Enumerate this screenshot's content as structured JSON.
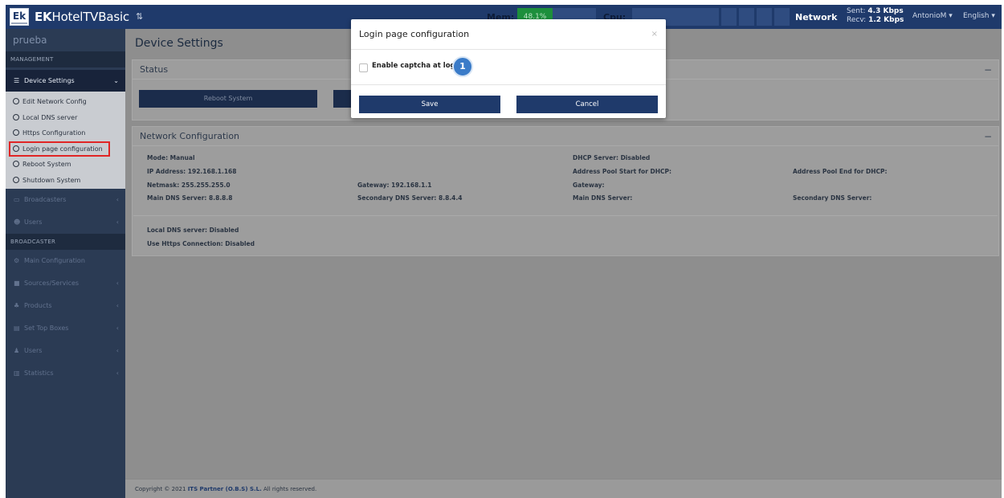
{
  "topbar": {
    "logo_text": "Ek",
    "brand_bold": "EK",
    "brand_rest": "HotelTVBasic",
    "toggle_glyph": "⇅",
    "mem_label": "Mem:",
    "mem_value": "48.1%",
    "mem_fraction": 0.45,
    "cpu_label": "Cpu:",
    "network_label": "Network",
    "sent_label": "Sent:",
    "sent_value": "4.3 Kbps",
    "recv_label": "Recv:",
    "recv_value": "1.2 Kbps",
    "user": "AntonioM ▾",
    "language": "English ▾"
  },
  "sidebar": {
    "site_name": "prueba",
    "management_header": "MANAGEMENT",
    "device_settings": "Device Settings",
    "sub_items": [
      "Edit Network Config",
      "Local DNS server",
      "Https Configuration",
      "Login page configuration",
      "Reboot System",
      "Shutdown System"
    ],
    "broadcasters": "Broadcasters",
    "users_mgmt": "Users",
    "broadcaster_header": "BROADCASTER",
    "bc_items": [
      "Main Configuration",
      "Sources/Services",
      "Products",
      "Set Top Boxes",
      "Users",
      "Statistics"
    ]
  },
  "main": {
    "page_title": "Device Settings",
    "status_panel_title": "Status",
    "reboot_button": "Reboot System",
    "network_panel_title": "Network Configuration",
    "mode": "Mode: Manual",
    "ip": "IP Address: 192.168.1.168",
    "netmask": "Netmask: 255.255.255.0",
    "gateway": "Gateway: 192.168.1.1",
    "main_dns": "Main DNS Server: 8.8.8.8",
    "secondary_dns": "Secondary DNS Server: 8.8.4.4",
    "dhcp_server": "DHCP Server: Disabled",
    "pool_start": "Address Pool Start for DHCP:",
    "pool_end": "Address Pool End for DHCP:",
    "dhcp_gateway": "Gateway:",
    "dhcp_main_dns": "Main DNS Server:",
    "dhcp_secondary_dns": "Secondary DNS Server:",
    "local_dns": "Local DNS server: Disabled",
    "https": "Use Https Connection: Disabled",
    "collapse_glyph": "−"
  },
  "footer": {
    "prefix": "Copyright © 2021 ",
    "company": "ITS Partner (O.B.S) S.L.",
    "suffix": " All rights reserved."
  },
  "modal": {
    "title": "Login page configuration",
    "close": "×",
    "checkbox_label": "Enable captcha at login",
    "checkbox_checked": false,
    "step_number": "1",
    "save": "Save",
    "cancel": "Cancel"
  },
  "colors": {
    "topbar": "#1f3a6b",
    "sidebar": "#2b3b54",
    "button": "#1f3a6b",
    "badge": "#3a7bc8",
    "highlight": "#e02525",
    "mem_fill": "#1d8f3c"
  }
}
